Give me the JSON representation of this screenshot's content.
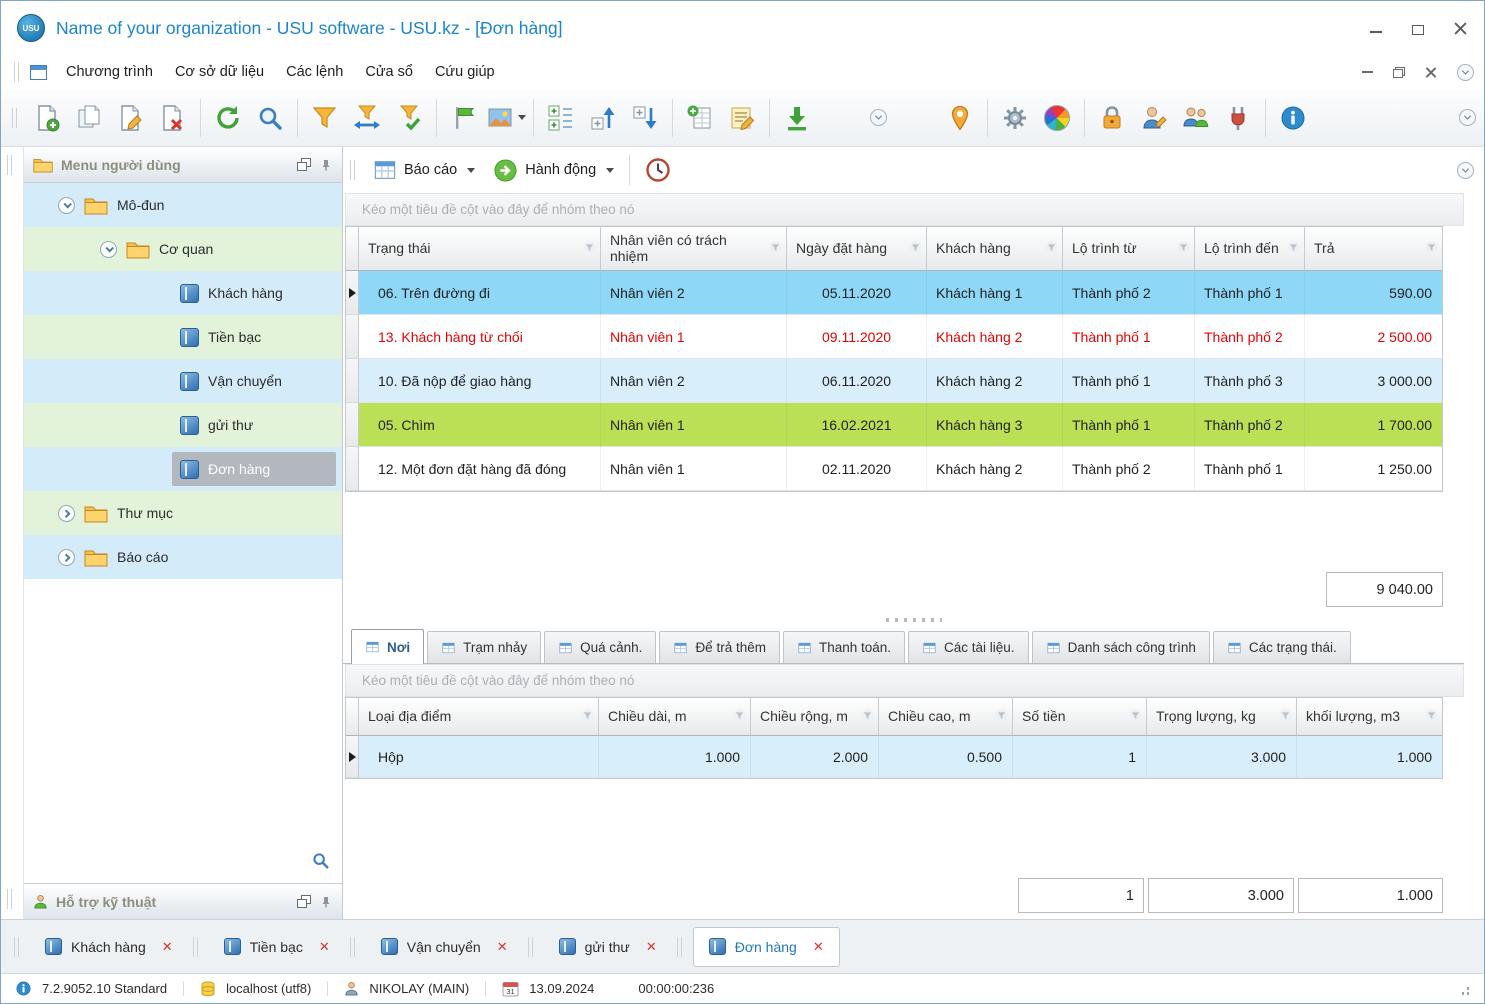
{
  "window": {
    "title": "Name of your organization - USU software - USU.kz - [Đơn hàng]",
    "logo": "USU"
  },
  "colors": {
    "title_text": "#1a86c5",
    "selected_row": "#8ed7f7",
    "highlight_row_blue": "#d9eefb",
    "highlight_row_green": "#bce055",
    "alert_text_red": "#e00504"
  },
  "menubar": {
    "items": [
      "Chương trình",
      "Cơ sở dữ liệu",
      "Các lệnh",
      "Cửa sổ",
      "Cứu giúp"
    ]
  },
  "toolbar": {
    "icons": [
      "new-record-icon",
      "copy-record-icon",
      "edit-record-icon",
      "delete-record-icon",
      "refresh-icon",
      "search-icon",
      "filter-funnel-icon",
      "filter-move-icon",
      "filter-apply-icon",
      "flag-icon",
      "image-report-icon",
      "tree-expand-icon",
      "tree-collapse-icon",
      "tree-collapse-branch-icon",
      "add-table-icon",
      "notes-icon",
      "export-download-icon",
      "overflow-arrow-icon",
      "location-pin-icon",
      "settings-gear-icon",
      "color-wheel-icon",
      "lock-icon",
      "user-edit-icon",
      "users-group-icon",
      "plugin-icon",
      "info-icon"
    ]
  },
  "actionbar": {
    "report_button": "Báo cáo",
    "action_button": "Hành động"
  },
  "sidebar": {
    "title": "Menu người dùng",
    "support_title": "Hỗ trợ kỹ thuật",
    "tree": [
      {
        "label": "Mô-đun"
      },
      {
        "label": "Cơ quan"
      },
      {
        "label": "Khách hàng"
      },
      {
        "label": "Tiền bạc"
      },
      {
        "label": "Vận chuyển"
      },
      {
        "label": "gửi thư"
      },
      {
        "label": "Đơn hàng"
      },
      {
        "label": "Thư mục"
      },
      {
        "label": "Báo cáo"
      }
    ]
  },
  "orders": {
    "group_hint": "Kéo một tiêu đề cột vào đây để nhóm theo nó",
    "columns": [
      "Trạng thái",
      "Nhân viên có trách nhiệm",
      "Ngày đặt hàng",
      "Khách hàng",
      "Lộ trình từ",
      "Lộ trình đến",
      "Trả"
    ],
    "rows": [
      {
        "status": "06. Trên đường đi",
        "employee": "Nhân viên 2",
        "date": "05.11.2020",
        "customer": "Khách hàng 1",
        "route_from": "Thành phố 2",
        "route_to": "Thành phố 1",
        "pay": "590.00"
      },
      {
        "status": "13. Khách hàng từ chối",
        "employee": "Nhân viên 1",
        "date": "09.11.2020",
        "customer": "Khách hàng 2",
        "route_from": "Thành phố 1",
        "route_to": "Thành phố 2",
        "pay": "2 500.00"
      },
      {
        "status": "10. Đã nộp để giao hàng",
        "employee": "Nhân viên 2",
        "date": "06.11.2020",
        "customer": "Khách hàng 2",
        "route_from": "Thành phố 1",
        "route_to": "Thành phố 3",
        "pay": "3 000.00"
      },
      {
        "status": "05. Chìm",
        "employee": "Nhân viên 1",
        "date": "16.02.2021",
        "customer": "Khách hàng 3",
        "route_from": "Thành phố 1",
        "route_to": "Thành phố 2",
        "pay": "1 700.00"
      },
      {
        "status": "12. Một đơn đặt hàng đã đóng",
        "employee": "Nhân viên 1",
        "date": "02.11.2020",
        "customer": "Khách hàng 2",
        "route_from": "Thành phố 2",
        "route_to": "Thành phố 1",
        "pay": "1 250.00"
      }
    ],
    "total": "9 040.00"
  },
  "detail_tabs": [
    "Nơi",
    "Trạm nhảy",
    "Quá cảnh.",
    "Để trả thêm",
    "Thanh toán.",
    "Các tài liệu.",
    "Danh sách công trình",
    "Các trạng thái."
  ],
  "places": {
    "group_hint": "Kéo một tiêu đề cột vào đây để nhóm theo nó",
    "columns": [
      "Loại địa điểm",
      "Chiều dài, m",
      "Chiều rộng, m",
      "Chiều cao, m",
      "Số tiền",
      "Trọng lượng, kg",
      "khối lượng, m3"
    ],
    "rows": [
      {
        "type": "Hộp",
        "length": "1.000",
        "width": "2.000",
        "height": "0.500",
        "amount": "1",
        "weight": "3.000",
        "volume": "1.000"
      }
    ],
    "totals": {
      "amount": "1",
      "weight": "3.000",
      "volume": "1.000"
    }
  },
  "window_tabs": [
    {
      "label": "Khách hàng"
    },
    {
      "label": "Tiền bạc"
    },
    {
      "label": "Vận chuyển"
    },
    {
      "label": "gửi thư"
    },
    {
      "label": "Đơn hàng"
    }
  ],
  "statusbar": {
    "version": "7.2.9052.10 Standard",
    "database": "localhost (utf8)",
    "user": "NIKOLAY (MAIN)",
    "calendar_day": "31",
    "date": "13.09.2024",
    "timer": "00:00:00:236"
  }
}
